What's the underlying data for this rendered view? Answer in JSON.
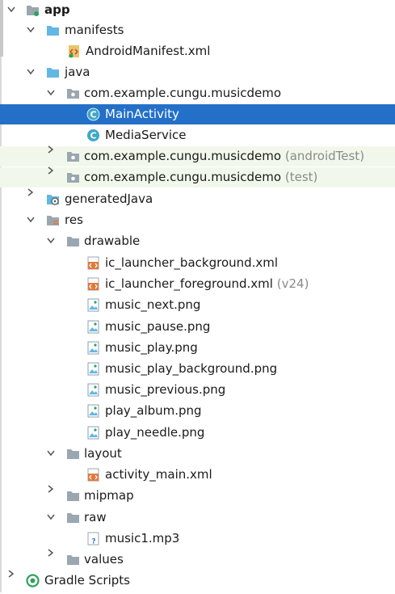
{
  "tree": {
    "app": "app",
    "manifests": "manifests",
    "android_manifest": "AndroidManifest.xml",
    "java": "java",
    "pkg_main": "com.example.cungu.musicdemo",
    "main_activity": "MainActivity",
    "media_service": "MediaService",
    "pkg_android_test": "com.example.cungu.musicdemo",
    "pkg_android_test_suffix": "(androidTest)",
    "pkg_test": "com.example.cungu.musicdemo",
    "pkg_test_suffix": "(test)",
    "generated_java": "generatedJava",
    "res": "res",
    "drawable": "drawable",
    "ic_launcher_background": "ic_launcher_background.xml",
    "ic_launcher_foreground": "ic_launcher_foreground.xml",
    "ic_launcher_foreground_suffix": "(v24)",
    "music_next": "music_next.png",
    "music_pause": "music_pause.png",
    "music_play": "music_play.png",
    "music_play_background": "music_play_background.png",
    "music_previous": "music_previous.png",
    "play_album": "play_album.png",
    "play_needle": "play_needle.png",
    "layout": "layout",
    "activity_main": "activity_main.xml",
    "mipmap": "mipmap",
    "raw": "raw",
    "music1": "music1.mp3",
    "values": "values",
    "gradle_scripts": "Gradle Scripts"
  },
  "colors": {
    "selected_bg": "#2470c8",
    "test_bg": "#f1f8eb",
    "folder_blue": "#62b7e3",
    "package_gray": "#9aa7b0",
    "class_teal": "#3fa7c9",
    "xml_orange": "#e07a3c",
    "gradle_green": "#2fa25c"
  }
}
